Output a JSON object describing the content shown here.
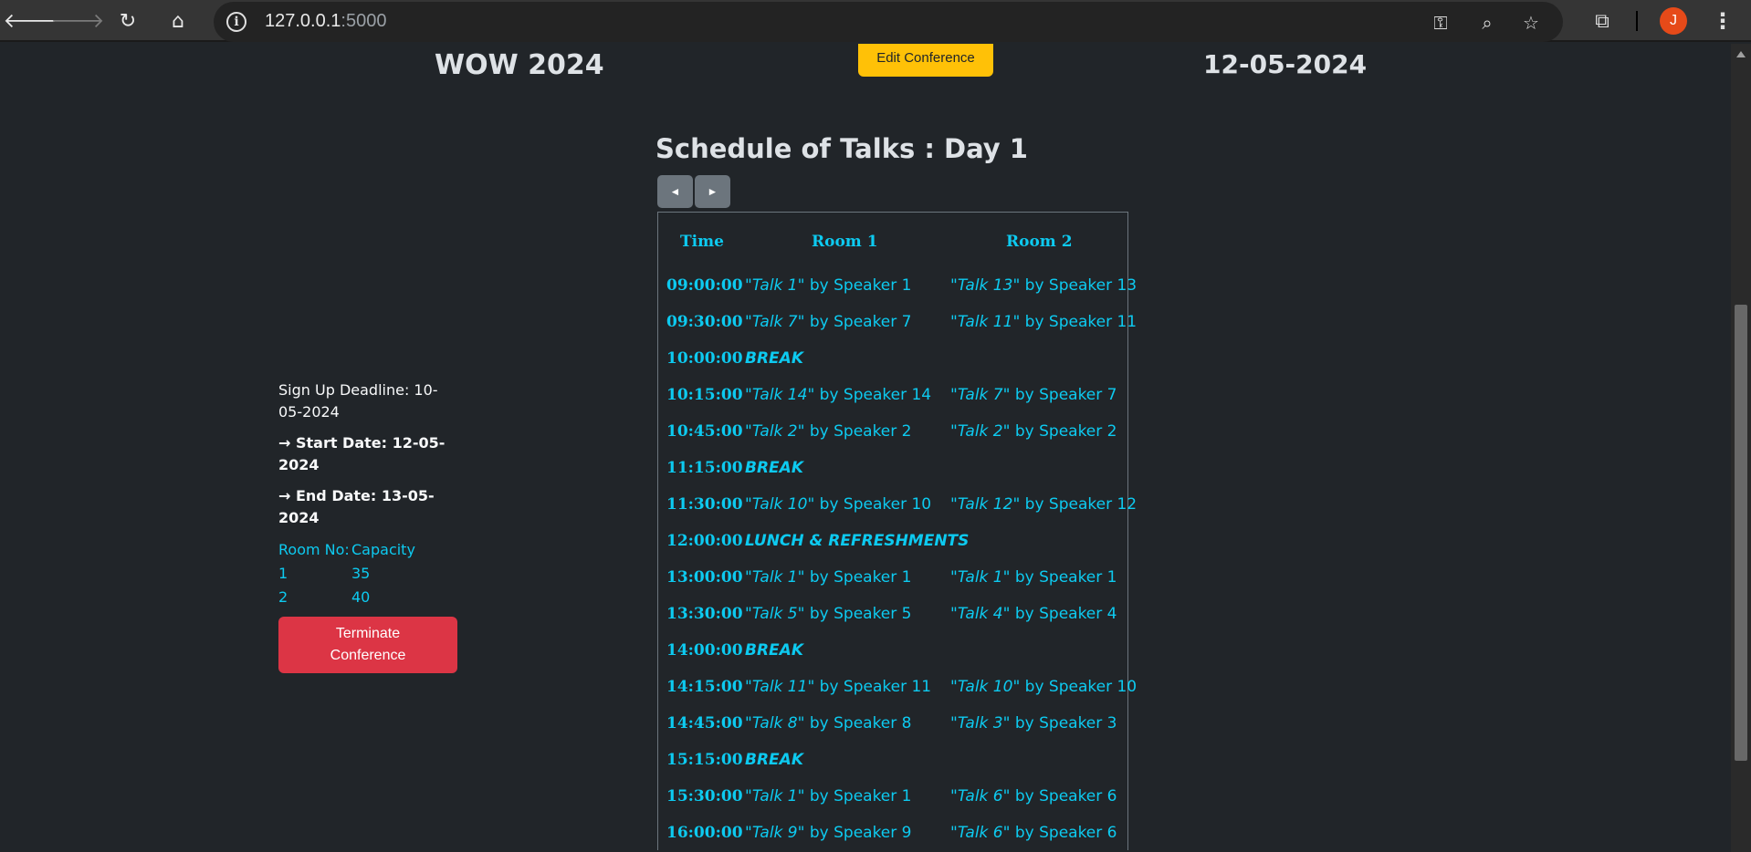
{
  "browser": {
    "url_host": "127.0.0.1",
    "url_port": ":5000",
    "avatar_letter": "J",
    "icons": [
      "back-icon",
      "forward-icon",
      "reload-icon",
      "home-icon",
      "site-info-icon",
      "password-key-icon",
      "zoom-icon",
      "bookmark-star-icon",
      "extensions-icon",
      "menu-icon"
    ]
  },
  "header": {
    "conference_name": "WOW 2024",
    "edit_label": "Edit Conference",
    "conference_date": "12-05-2024"
  },
  "schedule": {
    "title": "Schedule of Talks : Day 1",
    "prev_label": "◄",
    "next_label": "►",
    "columns": [
      "Time",
      "Room 1",
      "Room 2"
    ],
    "rows": [
      {
        "time": "09:00:00",
        "r1_talk": "\"Talk 1\"",
        "r1_by": " by Speaker 1",
        "r2_talk": "\"Talk 13\"",
        "r2_by": " by Speaker 13"
      },
      {
        "time": "09:30:00",
        "r1_talk": "\"Talk 7\"",
        "r1_by": " by Speaker 7",
        "r2_talk": "\"Talk 11\"",
        "r2_by": " by Speaker 11"
      },
      {
        "time": "10:00:00",
        "break": "BREAK"
      },
      {
        "time": "10:15:00",
        "r1_talk": "\"Talk 14\"",
        "r1_by": " by Speaker 14",
        "r2_talk": "\"Talk 7\"",
        "r2_by": " by Speaker 7"
      },
      {
        "time": "10:45:00",
        "r1_talk": "\"Talk 2\"",
        "r1_by": " by Speaker 2",
        "r2_talk": "\"Talk 2\"",
        "r2_by": " by Speaker 2"
      },
      {
        "time": "11:15:00",
        "break": "BREAK"
      },
      {
        "time": "11:30:00",
        "r1_talk": "\"Talk 10\"",
        "r1_by": " by Speaker 10",
        "r2_talk": "\"Talk 12\"",
        "r2_by": " by Speaker 12"
      },
      {
        "time": "12:00:00",
        "break": "LUNCH & REFRESHMENTS"
      },
      {
        "time": "13:00:00",
        "r1_talk": "\"Talk 1\"",
        "r1_by": " by Speaker 1",
        "r2_talk": "\"Talk 1\"",
        "r2_by": " by Speaker 1"
      },
      {
        "time": "13:30:00",
        "r1_talk": "\"Talk 5\"",
        "r1_by": " by Speaker 5",
        "r2_talk": "\"Talk 4\"",
        "r2_by": " by Speaker 4"
      },
      {
        "time": "14:00:00",
        "break": "BREAK"
      },
      {
        "time": "14:15:00",
        "r1_talk": "\"Talk 11\"",
        "r1_by": " by Speaker 11",
        "r2_talk": "\"Talk 10\"",
        "r2_by": " by Speaker 10"
      },
      {
        "time": "14:45:00",
        "r1_talk": "\"Talk 8\"",
        "r1_by": " by Speaker 8",
        "r2_talk": "\"Talk 3\"",
        "r2_by": " by Speaker 3"
      },
      {
        "time": "15:15:00",
        "break": "BREAK"
      },
      {
        "time": "15:30:00",
        "r1_talk": "\"Talk 1\"",
        "r1_by": " by Speaker 1",
        "r2_talk": "\"Talk 6\"",
        "r2_by": " by Speaker 6"
      },
      {
        "time": "16:00:00",
        "r1_talk": "\"Talk 9\"",
        "r1_by": " by Speaker 9",
        "r2_talk": "\"Talk 6\"",
        "r2_by": " by Speaker 6"
      }
    ]
  },
  "sidebar": {
    "signup_deadline": "Sign Up Deadline: 10-05-2024",
    "start_date": "→ Start Date: 12-05-2024",
    "end_date": "→ End Date: 13-05-2024",
    "capacity_headers": [
      "Room No:",
      "Capacity"
    ],
    "rooms": [
      {
        "room": "1",
        "capacity": "35"
      },
      {
        "room": "2",
        "capacity": "40"
      }
    ],
    "terminate_label": "Terminate Conference"
  },
  "colors": {
    "page_bg": "#212529",
    "accent_cyan": "#0dcaf0",
    "warning": "#ffc107",
    "danger": "#dc3545",
    "secondary": "#6c757d"
  }
}
